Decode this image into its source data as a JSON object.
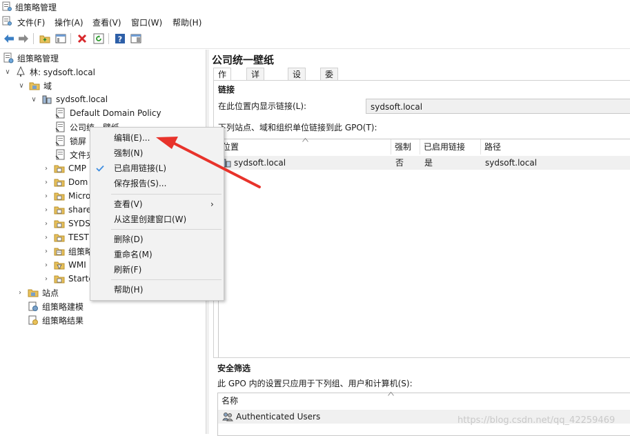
{
  "window": {
    "title": "组策略管理"
  },
  "menubar": {
    "items": [
      "文件(F)",
      "操作(A)",
      "查看(V)",
      "窗口(W)",
      "帮助(H)"
    ]
  },
  "tree": {
    "root": "组策略管理",
    "forest": "林: sydsoft.local",
    "domains": "域",
    "domain": "sydsoft.local",
    "children": [
      "Default Domain Policy",
      "公司统一壁纸",
      "锁屏",
      "文件夹",
      "CMP",
      "Dom",
      "Micro",
      "share",
      "SYDS",
      "TEST",
      "组策略",
      "WMI",
      "Starte"
    ],
    "sites": "站点",
    "modeling": "组策略建模",
    "results": "组策略结果"
  },
  "detail": {
    "title": "公司统一壁纸",
    "tabs": [
      "作用域",
      "详细信息",
      "设置",
      "委派"
    ],
    "links_heading": "链接",
    "location_label": "在此位置内显示链接(L):",
    "location_value": "sydsoft.local",
    "linked_label": "下列站点、域和组织单位链接到此 GPO(T):",
    "columns": [
      "位置",
      "强制",
      "已启用链接",
      "路径"
    ],
    "rows": [
      {
        "location": "sydsoft.local",
        "enforced": "否",
        "enabled": "是",
        "path": "sydsoft.local"
      }
    ],
    "security_heading": "安全筛选",
    "security_label": "此 GPO 内的设置只应用于下列组、用户和计算机(S):",
    "security_column": "名称",
    "security_rows": [
      "Authenticated Users"
    ]
  },
  "context_menu": {
    "items": [
      "编辑(E)...",
      "强制(N)",
      "已启用链接(L)",
      "保存报告(S)...",
      "查看(V)",
      "从这里创建窗口(W)",
      "删除(D)",
      "重命名(M)",
      "刷新(F)",
      "帮助(H)"
    ],
    "checked": "已启用链接(L)"
  },
  "watermark": "https://blog.csdn.net/qq_42259469",
  "colors": {
    "accent": "#3c8ce0",
    "arrow": "#e8332b",
    "selected_row": "#f0f0f0"
  }
}
